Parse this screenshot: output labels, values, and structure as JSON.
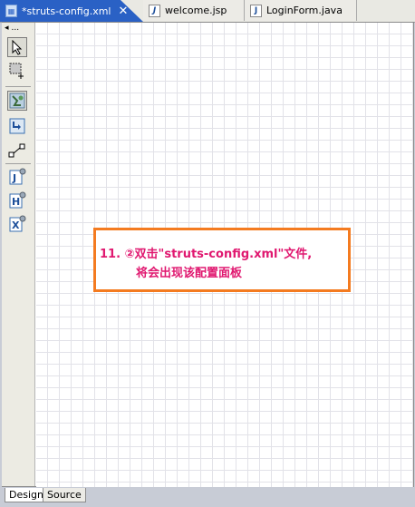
{
  "tabs": [
    {
      "label": "*struts-config.xml",
      "icon": "xml-file-icon",
      "active": true,
      "closable": true
    },
    {
      "label": "welcome.jsp",
      "icon": "jsp-file-icon"
    },
    {
      "label": "LoginForm.java",
      "icon": "java-file-icon"
    }
  ],
  "palette": {
    "header_glyph": "◂",
    "header_dots": "...",
    "tools": [
      {
        "name": "select-tool"
      },
      {
        "name": "marquee-tool"
      },
      {
        "name": "action-mapping-tool"
      },
      {
        "name": "forward-tool"
      },
      {
        "name": "connection-tool"
      },
      {
        "name": "jsp-page-tool",
        "glyph": "J"
      },
      {
        "name": "html-page-tool",
        "glyph": "H"
      },
      {
        "name": "xml-page-tool",
        "glyph": "X"
      }
    ]
  },
  "annotation": {
    "line1": "11. ②双击\"struts-config.xml\"文件,",
    "line2": "将会出现该配置面板",
    "color": "#e01870",
    "border_color": "#f47b20"
  },
  "bottom_tabs": [
    {
      "label": "Design",
      "active": true
    },
    {
      "label": "Source",
      "active": false
    }
  ]
}
